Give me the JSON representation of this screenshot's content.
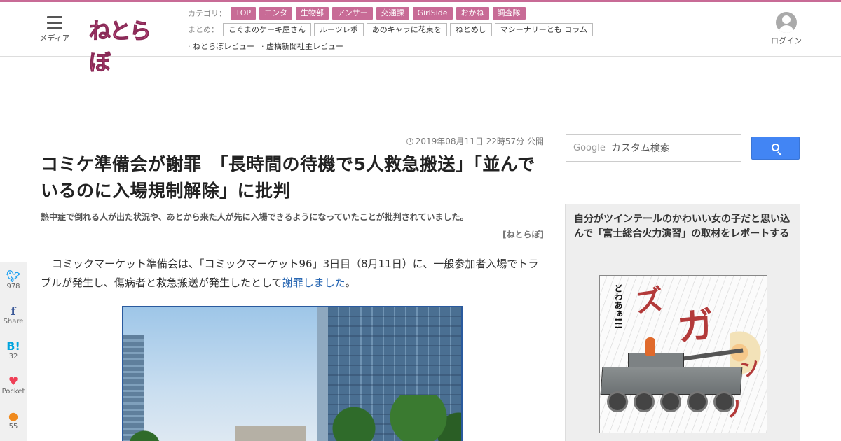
{
  "header": {
    "menu_label": "メディア",
    "logo_text": "ねとらぼ",
    "category_label": "カテゴリ：",
    "categories": [
      "TOP",
      "エンタ",
      "生物部",
      "アンサー",
      "交通課",
      "GirlSide",
      "おかね",
      "調査隊"
    ],
    "summary_label": "まとめ：",
    "summaries": [
      "こぐまのケーキ屋さん",
      "ルーツレポ",
      "あのキャラに花束を",
      "ねとめし",
      "マシーナリーとも コラム"
    ],
    "reviews": [
      "· ねとらぼレビュー",
      "· 虚構新聞社主レビュー"
    ],
    "login_label": "ログイン"
  },
  "article": {
    "timestamp": "2019年08月11日 22時57分 公開",
    "title": "コミケ準備会が謝罪　「長時間の待機で5人救急搬送」「並んでいるのに入場規制解除」に批判",
    "subtitle": "熱中症で倒れる人が出た状況や、あとから来た人が先に入場できるようになっていたことが批判されていました。",
    "source": "[ねとらぼ]",
    "body_text": "コミックマーケット準備会は、「コミックマーケット96」3日目（8月11日）に、一般参加者入場でトラブルが発生し、傷病者と救急搬送が発生したとして",
    "body_link": "謝罪しました",
    "body_end": "。"
  },
  "social": {
    "twitter_count": "978",
    "facebook_label": "Share",
    "hatena_count": "32",
    "pocket_label": "Pocket",
    "line_count": "55"
  },
  "search": {
    "brand": "Google",
    "placeholder": "カスタム検索"
  },
  "sidebar": {
    "feature_title": "自分がツインテールのかわいい女の子だと思い込んで「富士総合火力演習」の取材をレポートする",
    "manga_shout": "どわあぁ!!!"
  },
  "colors": {
    "brand_pink": "#c86b96",
    "link_blue": "#2a68b3",
    "search_blue": "#4285f4"
  }
}
